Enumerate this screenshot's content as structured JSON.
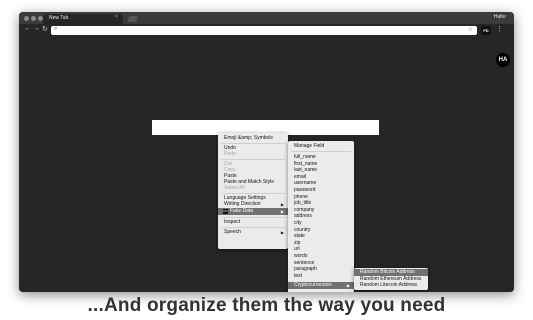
{
  "browser": {
    "tab_title": "New Tab",
    "tab_close": "×",
    "profile_name": "Hafer",
    "extension_label": "FD",
    "avatar_initials": "HA"
  },
  "context_menu": {
    "items": [
      {
        "label": "Emoji &amp; Symbols",
        "disabled": false
      },
      {
        "label": "Undo",
        "disabled": false
      },
      {
        "label": "Redo",
        "disabled": true
      },
      {
        "label": "Cut",
        "disabled": true
      },
      {
        "label": "Copy",
        "disabled": true
      },
      {
        "label": "Paste",
        "disabled": false
      },
      {
        "label": "Paste and Match Style",
        "disabled": false
      },
      {
        "label": "Select All",
        "disabled": true
      },
      {
        "label": "Language Settings",
        "disabled": false
      },
      {
        "label": "Writing Direction",
        "disabled": false
      },
      {
        "label": "Fake Data",
        "disabled": false
      },
      {
        "label": "Inspect",
        "disabled": false
      },
      {
        "label": "Speech",
        "disabled": false
      }
    ]
  },
  "fake_data_menu": {
    "manage": "Manage Field",
    "fields": [
      "full_name",
      "first_name",
      "last_name",
      "email",
      "username",
      "password",
      "phone",
      "job_title",
      "company",
      "address",
      "city",
      "country",
      "state",
      "zip",
      "url",
      "words",
      "sentence",
      "paragraph",
      "text"
    ],
    "crypto": "Cryptocurrencies"
  },
  "crypto_menu": {
    "items": [
      "Random Bitcoin Address",
      "Random Ethereum Address",
      "Random Litecoin Address"
    ]
  },
  "caption": "...And organize them the way you need"
}
